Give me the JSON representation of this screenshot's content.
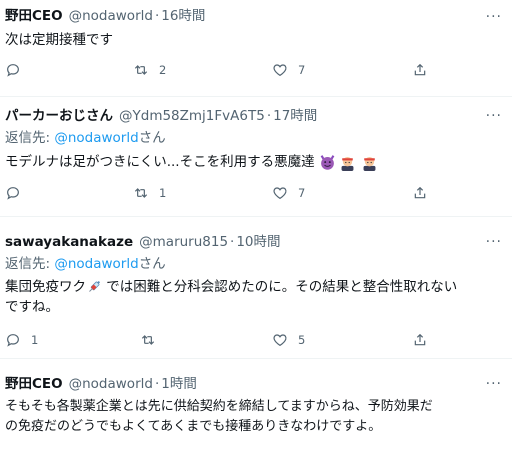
{
  "tweets": [
    {
      "name": "野田CEO",
      "handle": "@nodaworld",
      "dot": "·",
      "time": "16時間",
      "text": "次は定期接種です",
      "more": "···",
      "counts": {
        "reply": "",
        "retweet": "2",
        "like": "7"
      }
    },
    {
      "name": "パーカーおじさん",
      "handle": "@Ydm58Zmj1FvA6T5",
      "dot": "·",
      "time": "17時間",
      "reply_prefix": "返信先: ",
      "reply_mention": "@nodaworld",
      "reply_suffix": "さん",
      "text": "モデルナは足がつきにくい...そこを利用する悪魔達",
      "emojis": [
        "smiling-devil-emoji",
        "person-with-headband-emoji",
        "person-with-headband-emoji"
      ],
      "more": "···",
      "counts": {
        "reply": "",
        "retweet": "1",
        "like": "7"
      }
    },
    {
      "name": "sawayakanakaze",
      "handle": "@maruru815",
      "dot": "·",
      "time": "10時間",
      "reply_prefix": "返信先: ",
      "reply_mention": "@nodaworld",
      "reply_suffix": "さん",
      "text_a": "集団免疫ワク",
      "text_b": " では困難と分科会認めたのに。その結果と整合性取れない",
      "text_c": "ですね。",
      "emojis": [
        "syringe-emoji"
      ],
      "more": "···",
      "counts": {
        "reply": "1",
        "retweet": "",
        "like": "5"
      }
    },
    {
      "name": "野田CEO",
      "handle": "@nodaworld",
      "dot": "·",
      "time": "1時間",
      "text_a": "そもそも各製薬企業とは先に供給契約を締結してますからね、予防効果だ",
      "text_b": "の免疫だのどうでもよくてあくまでも接種ありきなわけですよ。",
      "more": "···"
    }
  ],
  "colors": {
    "text": "#0f1419",
    "secondary": "#536471",
    "link": "#1d9bf0",
    "divider": "#eff3f4"
  }
}
